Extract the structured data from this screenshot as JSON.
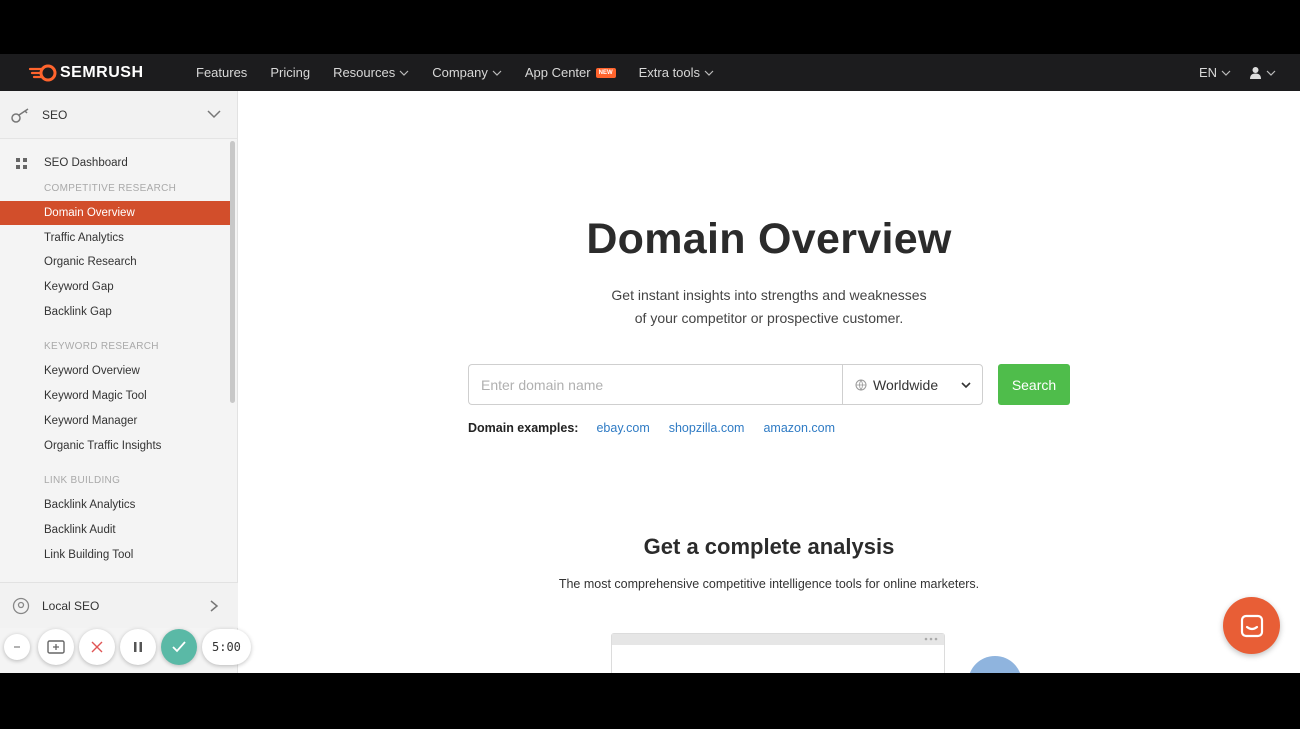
{
  "topnav": {
    "brand": "SEMRUSH",
    "items": [
      {
        "label": "Features",
        "dropdown": false
      },
      {
        "label": "Pricing",
        "dropdown": false
      },
      {
        "label": "Resources",
        "dropdown": true
      },
      {
        "label": "Company",
        "dropdown": true
      },
      {
        "label": "App Center",
        "dropdown": false,
        "badge": "NEW"
      },
      {
        "label": "Extra tools",
        "dropdown": true
      }
    ],
    "language": "EN",
    "user_icon": "user-icon"
  },
  "sidebar": {
    "section_title": "SEO",
    "dashboard": "SEO Dashboard",
    "groups": [
      {
        "heading": "COMPETITIVE RESEARCH",
        "items": [
          "Domain Overview",
          "Traffic Analytics",
          "Organic Research",
          "Keyword Gap",
          "Backlink Gap"
        ]
      },
      {
        "heading": "KEYWORD RESEARCH",
        "items": [
          "Keyword Overview",
          "Keyword Magic Tool",
          "Keyword Manager",
          "Organic Traffic Insights"
        ]
      },
      {
        "heading": "LINK BUILDING",
        "items": [
          "Backlink Analytics",
          "Backlink Audit",
          "Link Building Tool"
        ]
      }
    ],
    "active_item": "Domain Overview",
    "local_seo": "Local SEO"
  },
  "main": {
    "title": "Domain Overview",
    "subtitle_line1": "Get instant insights into strengths and weaknesses",
    "subtitle_line2": "of your competitor or prospective customer.",
    "search": {
      "placeholder": "Enter domain name",
      "value": "",
      "region": "Worldwide",
      "button": "Search"
    },
    "examples_label": "Domain examples:",
    "examples": [
      "ebay.com",
      "shopzilla.com",
      "amazon.com"
    ],
    "section_title": "Get a complete analysis",
    "section_subtitle": "The most comprehensive competitive intelligence tools for online marketers."
  },
  "recorder": {
    "timer": "5:00"
  },
  "colors": {
    "brand_orange": "#ff642d",
    "active_item": "#d24e2b",
    "search_green": "#4fbd4b",
    "link_blue": "#2f7bc4",
    "nav_bg": "#1c1c1e",
    "chat_orange": "#e85e36",
    "recorder_check": "#5ab9a6"
  }
}
